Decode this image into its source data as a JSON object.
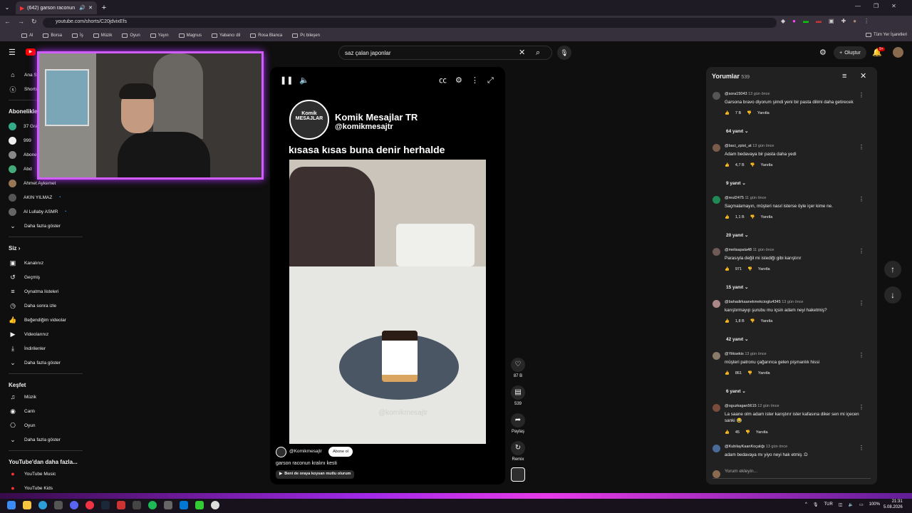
{
  "browser": {
    "tab_title": "(642) garson raconun kralını",
    "url": "youtube.com/shorts/C20jdvixEfs",
    "bookmarks": [
      "Al",
      "Borsa",
      "İş",
      "Müzik",
      "Oyun",
      "Yayın",
      "Magnus",
      "Yabancı dil",
      "Rosa Blanca",
      "Pc bileşen"
    ],
    "bookmarks_right": "Tüm Yer İşaretleri"
  },
  "header": {
    "search_value": "saz çalan japonlar",
    "create_label": "Oluştur",
    "notif_badge": "9+"
  },
  "sidebar": {
    "top_items": [
      {
        "icon": "home-icon",
        "label": "Ana Sayfa"
      },
      {
        "icon": "shorts-icon",
        "label": "Shorts"
      }
    ],
    "subs_heading": "Abonelikler",
    "subs": [
      "37 Gram",
      "999",
      "Abone",
      "Abd",
      "Ahmet Aykemet",
      "AKIN YILMAZ",
      "Al Lullaby ASMR"
    ],
    "subs_more": "Daha fazla göster",
    "you_heading": "Siz",
    "you_items": [
      "Kanalınız",
      "Geçmiş",
      "Oynatma listeleri",
      "Daha sonra izle",
      "Beğendiğim videolar",
      "Videolarınız",
      "İndirilenler",
      "Daha fazla göster"
    ],
    "explore_heading": "Keşfet",
    "explore_items": [
      "Müzik",
      "Canlı",
      "Oyun",
      "Daha fazla göster"
    ],
    "more_heading": "YouTube'dan daha fazla...",
    "more_items": [
      "YouTube Music",
      "YouTube Kids"
    ]
  },
  "video": {
    "logo_text": "Komik MESAJLAR",
    "channel_title": "Komik Mesajlar TR",
    "channel_handle": "@komikmesajtr",
    "caption": "kısasa kısas buna denir herhalde",
    "watermark": "@komikmesajtr",
    "bottom_handle": "@Komikmesajtr",
    "subscribe_label": "Abone ol",
    "title": "garson raconun kralını kesti",
    "music": "Beni de oraya koysan mutlu olurum"
  },
  "actions": {
    "likes": "87 B",
    "comments": "539",
    "share": "Paylaş",
    "remix": "Remix"
  },
  "comments_panel": {
    "title": "Yorumlar",
    "count": "539",
    "add_placeholder": "Yorum ekleyin...",
    "reply_label": "Yanıtla",
    "items": [
      {
        "user": "@sora15043",
        "time": "13 gün önce",
        "text": "Garsona bravo diyorum şimdi yeni bir pasta dilimi daha getirecek",
        "likes": "7 B",
        "replies": "64 yanıt"
      },
      {
        "user": "@baci_zpist_at",
        "time": "13 gün önce",
        "text": "Adam bedavaya bir pasta daha yedi",
        "likes": "4,7 B",
        "replies": "9 yanıt"
      },
      {
        "user": "@reul2475",
        "time": "11 gün önce",
        "text": "Saçmalamayın, müşteri nasıl isterse öyle içer kime ne.",
        "likes": "1,1 B",
        "replies": "20 yanıt"
      },
      {
        "user": "@melisapala48",
        "time": "11 gün önce",
        "text": "Parasıyla değil mi istediği gibi karıştırır",
        "likes": "971",
        "replies": "15 yanıt"
      },
      {
        "user": "@bahadirkaanekmekcioglu4345",
        "time": "13 gün önce",
        "text": "karıştırmayıp şurubu mu içsin adam neyi haketmiş?",
        "likes": "1,8 B",
        "replies": "42 yanıt"
      },
      {
        "user": "@Yiiksekis",
        "time": "13 gün önce",
        "text": "müşteri patronu çağarınca gelen pişmanlık hissi",
        "likes": "861",
        "replies": "6 yanıt"
      },
      {
        "user": "@oguzkagan5615",
        "time": "12 gün önce",
        "text": "La saane olm adam ister karıştırır ister kafasına diker sen mi içecen sanki 😂",
        "likes": "45",
        "replies": ""
      },
      {
        "user": "@KubilayKaanKoçalığı",
        "time": "13 gün önce",
        "text": "adam bedavaya mı yiyo neyi hak etmiş :D",
        "likes": "",
        "replies": ""
      }
    ]
  },
  "taskbar": {
    "lang": "TUR",
    "battery": "100%",
    "time": "21:31",
    "date": "5.08.2026"
  }
}
